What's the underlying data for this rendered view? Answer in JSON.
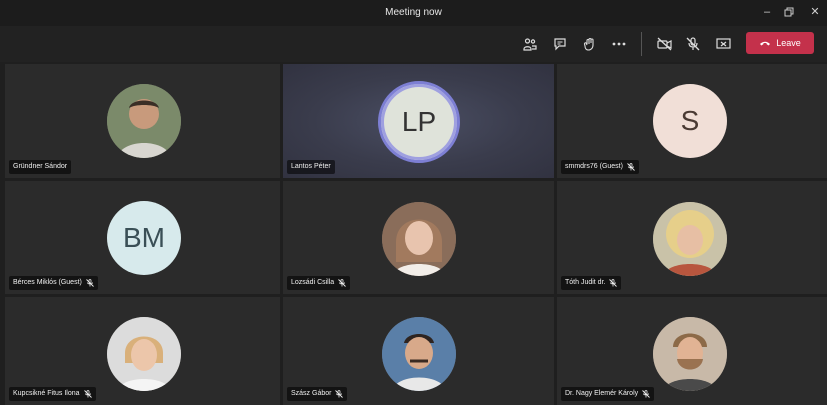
{
  "window": {
    "title": "Meeting now"
  },
  "toolbar": {
    "leave_label": "Leave",
    "icons": [
      "participants-icon",
      "chat-icon",
      "raise-hand-icon",
      "more-icon",
      "camera-off-icon",
      "mic-off-icon",
      "share-icon"
    ]
  },
  "participants": [
    {
      "name": "Gründner Sándor",
      "avatar": "photo",
      "muted": false
    },
    {
      "name": "Lantos Péter",
      "avatar": "LP",
      "muted": false,
      "speaking": true
    },
    {
      "name": "smmdrs76 (Guest)",
      "avatar": "S",
      "muted": true
    },
    {
      "name": "Bérces Miklós (Guest)",
      "avatar": "BM",
      "muted": true
    },
    {
      "name": "Lozsádi Csilla",
      "avatar": "photo",
      "muted": true
    },
    {
      "name": "Tóth Judit dr.",
      "avatar": "photo",
      "muted": true
    },
    {
      "name": "Kupcsikné Fitus Ilona",
      "avatar": "photo",
      "muted": true
    },
    {
      "name": "Szász Gábor",
      "avatar": "photo",
      "muted": true
    },
    {
      "name": "Dr. Nagy Elemér Károly",
      "avatar": "photo",
      "muted": true
    }
  ]
}
